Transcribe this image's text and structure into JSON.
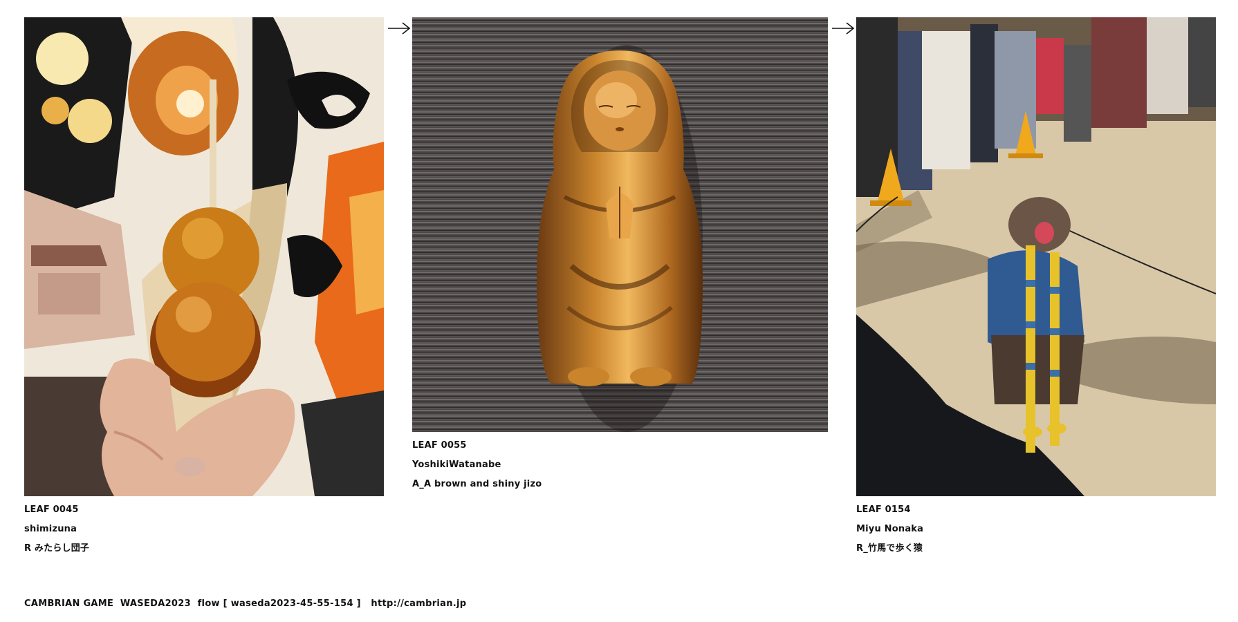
{
  "leaves": [
    {
      "id": "LEAF 0045",
      "author": "shimizuna",
      "caption": "R みたらし団子",
      "image": "dango-on-skewer-photo"
    },
    {
      "id": "LEAF 0055",
      "author": "YoshikiWatanabe",
      "caption": "A_A brown and shiny jizo",
      "image": "bronze-jizo-statue-image"
    },
    {
      "id": "LEAF 0154",
      "author": "Miyu Nonaka",
      "caption": "R_竹馬で歩く猿",
      "image": "monkey-on-stilts-photo"
    }
  ],
  "flow": {
    "arrow_icon": "right-arrow-icon"
  },
  "footer": {
    "text": "CAMBRIAN GAME  WASEDA2023  flow [ waseda2023-45-55-154 ]   http://cambrian.jp"
  }
}
